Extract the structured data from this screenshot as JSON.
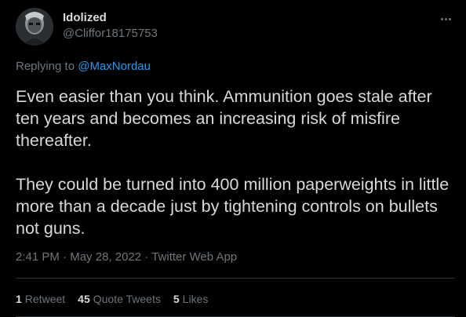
{
  "tweet": {
    "author": {
      "display_name": "Idolized",
      "handle": "@Cliffor18175753"
    },
    "more_icon": "ellipsis-icon",
    "replying": {
      "prefix": "Replying to",
      "mention": "@MaxNordau"
    },
    "body": {
      "p1": "Even easier than you think.  Ammunition goes stale after ten years and becomes an increasing risk of misfire thereafter.",
      "p2": "They could be turned into 400 million paperweights in little more than a decade just by tightening controls on bullets not guns."
    },
    "meta": {
      "time": "2:41 PM",
      "sep1": " · ",
      "date": "May 28, 2022",
      "sep2": " · ",
      "source": "Twitter Web App"
    },
    "stats": {
      "retweets": {
        "count": "1",
        "label": "Retweet"
      },
      "quotes": {
        "count": "45",
        "label": "Quote Tweets"
      },
      "likes": {
        "count": "5",
        "label": "Likes"
      }
    },
    "colors": {
      "background": "#000000",
      "text": "#d9d9d9",
      "secondary": "#6e767d",
      "link": "#1d9bf0",
      "divider": "#2f3336"
    }
  }
}
